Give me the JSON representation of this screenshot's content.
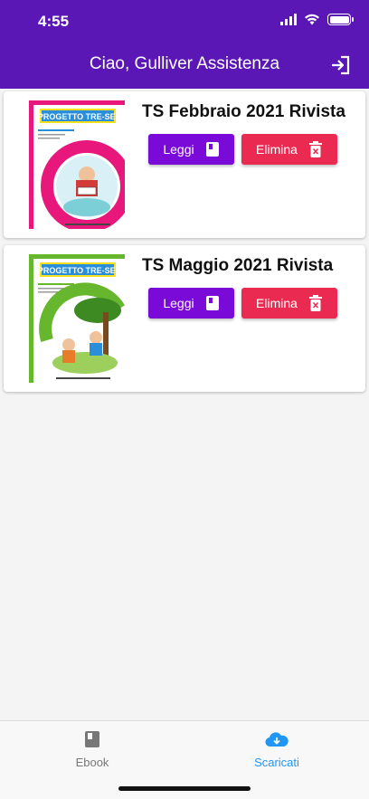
{
  "status": {
    "time": "4:55"
  },
  "header": {
    "title": "Ciao, Gulliver Assistenza",
    "logout_icon": "logout-icon"
  },
  "ebooks": [
    {
      "title": "TS Febbraio 2021 Rivista",
      "read_label": "Leggi",
      "delete_label": "Elimina",
      "cover": {
        "brand": "PROGETTO TRE-SEI",
        "accent": "#e8177b"
      }
    },
    {
      "title": "TS Maggio 2021 Rivista",
      "read_label": "Leggi",
      "delete_label": "Elimina",
      "cover": {
        "brand": "PROGETTO TRE-SEI",
        "accent": "#67b72e"
      }
    }
  ],
  "tabs": [
    {
      "label": "Ebook",
      "icon": "book-icon",
      "active": false
    },
    {
      "label": "Scaricati",
      "icon": "cloud-download-icon",
      "active": true
    }
  ],
  "colors": {
    "header": "#5b17b5",
    "read": "#7a0ad8",
    "delete": "#eb2a52",
    "active_tab": "#2196f3",
    "inactive_tab": "#777777"
  }
}
